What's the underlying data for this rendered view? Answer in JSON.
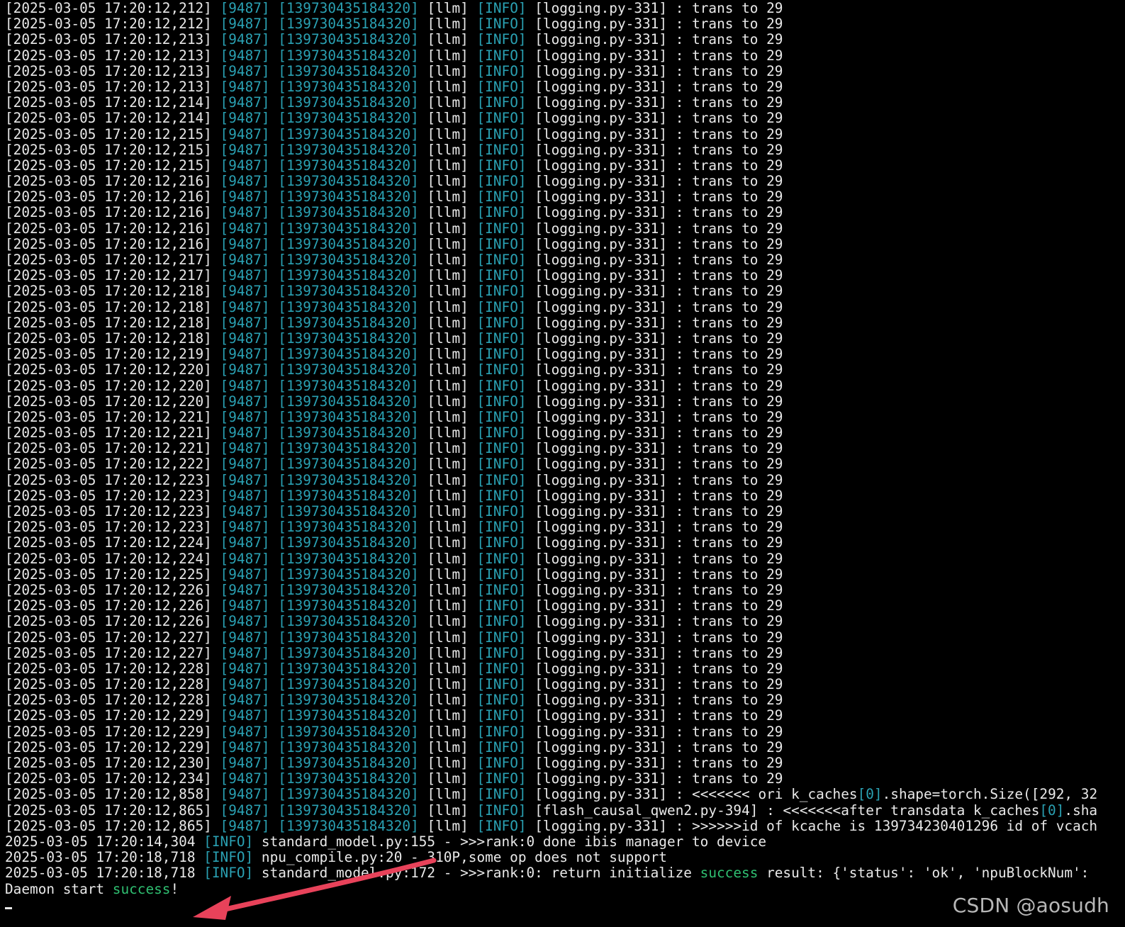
{
  "terminal": {
    "line_prefix": "[2025-03-05 17:20:12,",
    "pid": "[9487]",
    "thread": "[139730435184320]",
    "module": "[llm]",
    "level": "[INFO]",
    "source": "[logging.py-331]",
    "message": ": trans to 29",
    "trans_ms": [
      "212",
      "212",
      "213",
      "213",
      "213",
      "213",
      "214",
      "214",
      "215",
      "215",
      "215",
      "216",
      "216",
      "216",
      "216",
      "216",
      "217",
      "217",
      "218",
      "218",
      "218",
      "218",
      "219",
      "220",
      "220",
      "220",
      "221",
      "221",
      "221",
      "222",
      "223",
      "223",
      "223",
      "223",
      "224",
      "224",
      "225",
      "226",
      "226",
      "226",
      "227",
      "227",
      "228",
      "228",
      "228",
      "229",
      "229",
      "229",
      "230",
      "234"
    ],
    "detail_lines": [
      {
        "ts": "[2025-03-05 17:20:12,858]",
        "source": "[logging.py-331]",
        "msg_a": ": <<<<<<< ori k_caches",
        "msg_b": "[0]",
        "msg_c": ".shape=torch.Size([292, 32"
      },
      {
        "ts": "[2025-03-05 17:20:12,865]",
        "source": "[flash_causal_qwen2.py-394]",
        "msg_a": ": <<<<<<<after transdata k_caches",
        "msg_b": "[0]",
        "msg_c": ".sha"
      },
      {
        "ts": "[2025-03-05 17:20:12,865]",
        "source": "[logging.py-331]",
        "msg_a": ": >>>>>>id of kcache is 139734230401296 id of vcach",
        "msg_b": "",
        "msg_c": ""
      }
    ],
    "plain_lines": [
      {
        "ts": "2025-03-05 17:20:14,304",
        "level": "[INFO]",
        "msg_a": " standard_model.py:155 - >>>rank:0 done ibis manager to device",
        "msg_b": "",
        "msg_c": ""
      },
      {
        "ts": "2025-03-05 17:20:18,718",
        "level": "[INFO]",
        "msg_a": " npu_compile.py:20 - 310P,some op does not support",
        "msg_b": "",
        "msg_c": ""
      },
      {
        "ts": "2025-03-05 17:20:18,718",
        "level": "[INFO]",
        "msg_a": " standard_model.py:172 - >>>rank:0: return initialize ",
        "msg_b": "success",
        "msg_c": " result: {'status': 'ok', 'npuBlockNum':"
      }
    ],
    "daemon_line": {
      "prefix": "Daemon start ",
      "status": "success",
      "suffix": "!"
    }
  },
  "watermark": "CSDN @aosudh",
  "colors": {
    "background": "#000000",
    "text": "#e9e9e9",
    "cyan": "#2aa1b3",
    "green": "#2fbf71",
    "arrow": "#e8425a"
  }
}
